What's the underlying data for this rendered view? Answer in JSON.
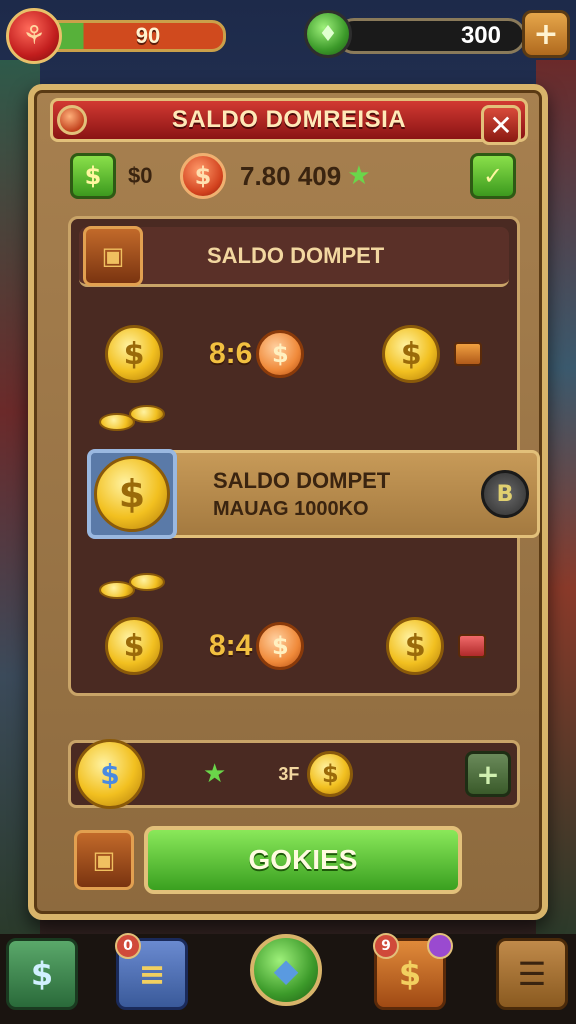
{
  "hud": {
    "left_value": "90",
    "right_value": "300",
    "left_badge_icon": "shield-icon",
    "right_gem_icon": "gem-icon",
    "plus": "+"
  },
  "panel": {
    "title": "SALDO DOMREISIA",
    "close": "✕",
    "stats": {
      "small": "$0",
      "big": "7.80 409"
    },
    "section": {
      "header": "SALDO DOMPET",
      "row1_count": "8:6",
      "wallet_title": "SALDO DOMPET",
      "wallet_sub": "MAUAG 1000KO",
      "wallet_btn": "B",
      "row2_count": "8:4"
    },
    "bottom_row": {
      "label": "3F"
    },
    "action_button": "GOKIES"
  },
  "nav": {
    "items": [
      {
        "name": "wallet",
        "icon": "$"
      },
      {
        "name": "cash",
        "icon": "≡"
      },
      {
        "name": "gem",
        "icon": "◆"
      },
      {
        "name": "coins",
        "icon": "$"
      },
      {
        "name": "menu",
        "icon": "☰"
      }
    ],
    "badge_2": "0",
    "badge_4": "9"
  },
  "colors": {
    "panel_bg": "#8d6a3e",
    "title_red": "#d23a32",
    "gold": "#f2c020",
    "green_button": "#3aa020"
  }
}
